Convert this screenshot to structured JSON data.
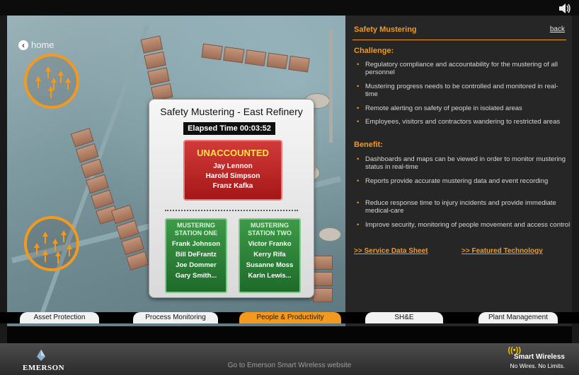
{
  "nav": {
    "home_label": "home"
  },
  "dialog": {
    "title": "Safety Mustering - East Refinery",
    "elapsed_label": "Elapsed Time",
    "elapsed_time": "00:03:52",
    "unaccounted": {
      "title": "UNACCOUNTED",
      "names": [
        "Jay Lennon",
        "Harold Simpson",
        "Franz Kafka"
      ]
    },
    "stations": [
      {
        "title_line1": "MUSTERING",
        "title_line2": "STATION ONE",
        "names": [
          "Frank Johnson",
          "Bill DeFrantz",
          "Joe Dommer",
          "Gary Smith..."
        ]
      },
      {
        "title_line1": "MUSTERING",
        "title_line2": "STATION TWO",
        "names": [
          "Victor Franko",
          "Kerry Rifa",
          "Susanne Moss",
          "Karin Lewis..."
        ]
      }
    ]
  },
  "tabs": [
    {
      "label": "Asset Protection",
      "active": false
    },
    {
      "label": "Process Monitoring",
      "active": false
    },
    {
      "label": "People & Productivity",
      "active": true
    },
    {
      "label": "SH&E",
      "active": false
    },
    {
      "label": "Plant Management",
      "active": false
    }
  ],
  "panel": {
    "title": "Safety Mustering",
    "back_label": "back",
    "challenge_heading": "Challenge:",
    "challenges": [
      "Regulatory compliance and accountability for the mustering of all personnel",
      "Mustering progress needs to be controlled and monitored in real-time",
      "Remote alerting on safety of people in isolated areas",
      "Employees, visitors and contractors wandering to restricted areas"
    ],
    "benefit_heading": "Benefit:",
    "benefits": [
      "Dashboards and maps can be viewed in order to monitor mustering status in real-time",
      "Reports provide accurate mustering data and event recording",
      "Reduce response time to injury incidents and provide immediate medical-care",
      "Improve security, monitoring of people movement and access control"
    ],
    "link_service": ">> Service Data Sheet",
    "link_technology": ">> Featured Technology"
  },
  "footer": {
    "brand": "EMERSON",
    "website_link": "Go to Emerson Smart Wireless website",
    "sw_title": "Smart Wireless",
    "sw_tagline": "No Wires. No Limits."
  },
  "colors": {
    "accent": "#f39a1e",
    "alert_red": "#b81f1f",
    "station_green": "#2f8a3b",
    "panel_bg": "#262626"
  },
  "icons": {
    "home": "back-arrow-icon",
    "speaker": "speaker-icon",
    "wireless": "wireless-signal-icon",
    "muster": "up-arrow-icon"
  }
}
